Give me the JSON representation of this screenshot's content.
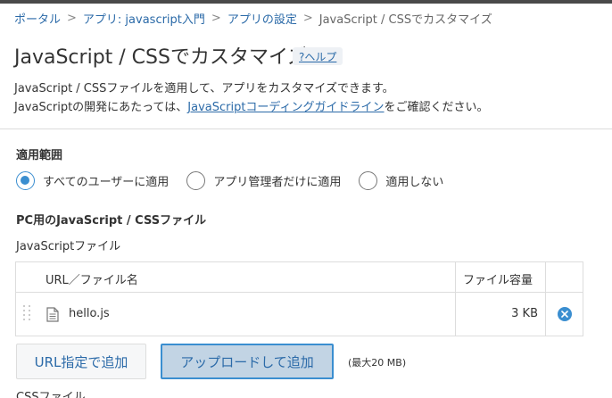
{
  "breadcrumb": {
    "items": [
      "ポータル",
      "アプリ: javascript入門",
      "アプリの設定"
    ],
    "current": "JavaScript / CSSでカスタマイズ",
    "separator": ">"
  },
  "header": {
    "title": "JavaScript / CSSでカスタマイズ",
    "help_label": "?ヘルプ"
  },
  "description": {
    "line1": "JavaScript / CSSファイルを適用して、アプリをカスタマイズできます。",
    "line2_prefix": "JavaScriptの開発にあたっては、",
    "line2_link": "JavaScriptコーディングガイドライン",
    "line2_suffix": "をご確認ください。"
  },
  "scope": {
    "label": "適用範囲",
    "options": [
      {
        "label": "すべてのユーザーに適用",
        "checked": true
      },
      {
        "label": "アプリ管理者だけに適用",
        "checked": false
      },
      {
        "label": "適用しない",
        "checked": false
      }
    ]
  },
  "pc_files": {
    "title": "PC用のJavaScript / CSSファイル",
    "js_label": "JavaScriptファイル",
    "columns": [
      "URL／ファイル名",
      "ファイル容量"
    ],
    "rows": [
      {
        "name": "hello.js",
        "size": "3 KB"
      }
    ],
    "add_url_label": "URL指定で追加",
    "upload_label": "アップロードして追加",
    "max_note": "(最大20 MB)",
    "css_label": "CSSファイル"
  },
  "colors": {
    "accent": "#3a8ed0",
    "link": "#2b6aa8",
    "border": "#dddddd"
  }
}
